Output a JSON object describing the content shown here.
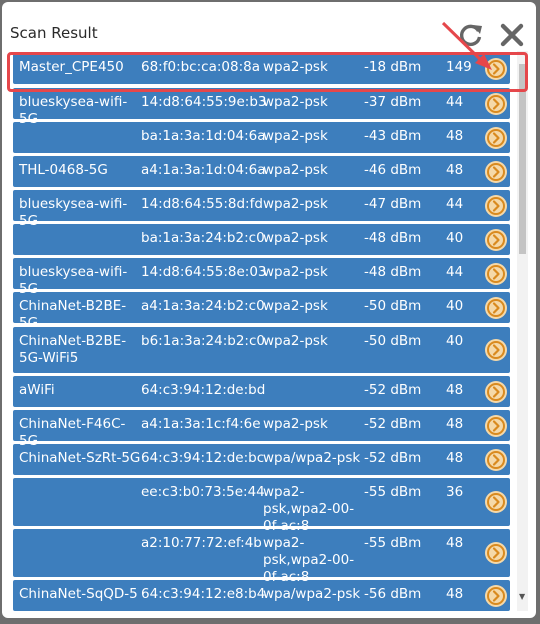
{
  "dialog": {
    "title": "Scan Result"
  },
  "icons": {
    "refresh": "refresh-icon",
    "close": "close-icon",
    "row_action": "chevron-right-circle-icon"
  },
  "colors": {
    "row_bg": "#3d7ebd",
    "highlight": "#e5474b",
    "action_circle": "#f5d9a9"
  },
  "networks": [
    {
      "ssid": "Master_CPE450",
      "bssid": "68:f0:bc:ca:08:8a",
      "security": "wpa2-psk",
      "signal": "-18 dBm",
      "channel": "149"
    },
    {
      "ssid": "blueskysea-wifi-5G",
      "bssid": "14:d8:64:55:9e:b3",
      "security": "wpa2-psk",
      "signal": "-37 dBm",
      "channel": "44"
    },
    {
      "ssid": "",
      "bssid": "ba:1a:3a:1d:04:6a",
      "security": "wpa2-psk",
      "signal": "-43 dBm",
      "channel": "48"
    },
    {
      "ssid": "THL-0468-5G",
      "bssid": "a4:1a:3a:1d:04:6a",
      "security": "wpa2-psk",
      "signal": "-46 dBm",
      "channel": "48"
    },
    {
      "ssid": "blueskysea-wifi-5G",
      "bssid": "14:d8:64:55:8d:fd",
      "security": "wpa2-psk",
      "signal": "-47 dBm",
      "channel": "44"
    },
    {
      "ssid": "",
      "bssid": "ba:1a:3a:24:b2:c0",
      "security": "wpa2-psk",
      "signal": "-48 dBm",
      "channel": "40"
    },
    {
      "ssid": "blueskysea-wifi-5G",
      "bssid": "14:d8:64:55:8e:03",
      "security": "wpa2-psk",
      "signal": "-48 dBm",
      "channel": "44"
    },
    {
      "ssid": "ChinaNet-B2BE-5G",
      "bssid": "a4:1a:3a:24:b2:c0",
      "security": "wpa2-psk",
      "signal": "-50 dBm",
      "channel": "40"
    },
    {
      "ssid": "ChinaNet-B2BE-5G-WiFi5",
      "bssid": "b6:1a:3a:24:b2:c0",
      "security": "wpa2-psk",
      "signal": "-50 dBm",
      "channel": "40"
    },
    {
      "ssid": "aWiFi",
      "bssid": "64:c3:94:12:de:bd",
      "security": "",
      "signal": "-52 dBm",
      "channel": "48"
    },
    {
      "ssid": "ChinaNet-F46C-5G",
      "bssid": "a4:1a:3a:1c:f4:6e",
      "security": "wpa2-psk",
      "signal": "-52 dBm",
      "channel": "48"
    },
    {
      "ssid": "ChinaNet-SzRt-5G",
      "bssid": "64:c3:94:12:de:bc",
      "security": "wpa/wpa2-psk",
      "signal": "-52 dBm",
      "channel": "48"
    },
    {
      "ssid": "",
      "bssid": "ee:c3:b0:73:5e:44",
      "security": "wpa2-psk,wpa2-00-0f-ac:8",
      "signal": "-55 dBm",
      "channel": "36"
    },
    {
      "ssid": "",
      "bssid": "a2:10:77:72:ef:4b",
      "security": "wpa2-psk,wpa2-00-0f-ac:8",
      "signal": "-55 dBm",
      "channel": "48"
    },
    {
      "ssid": "ChinaNet-SqQD-5",
      "bssid": "64:c3:94:12:e8:b4",
      "security": "wpa/wpa2-psk",
      "signal": "-56 dBm",
      "channel": "48"
    }
  ]
}
